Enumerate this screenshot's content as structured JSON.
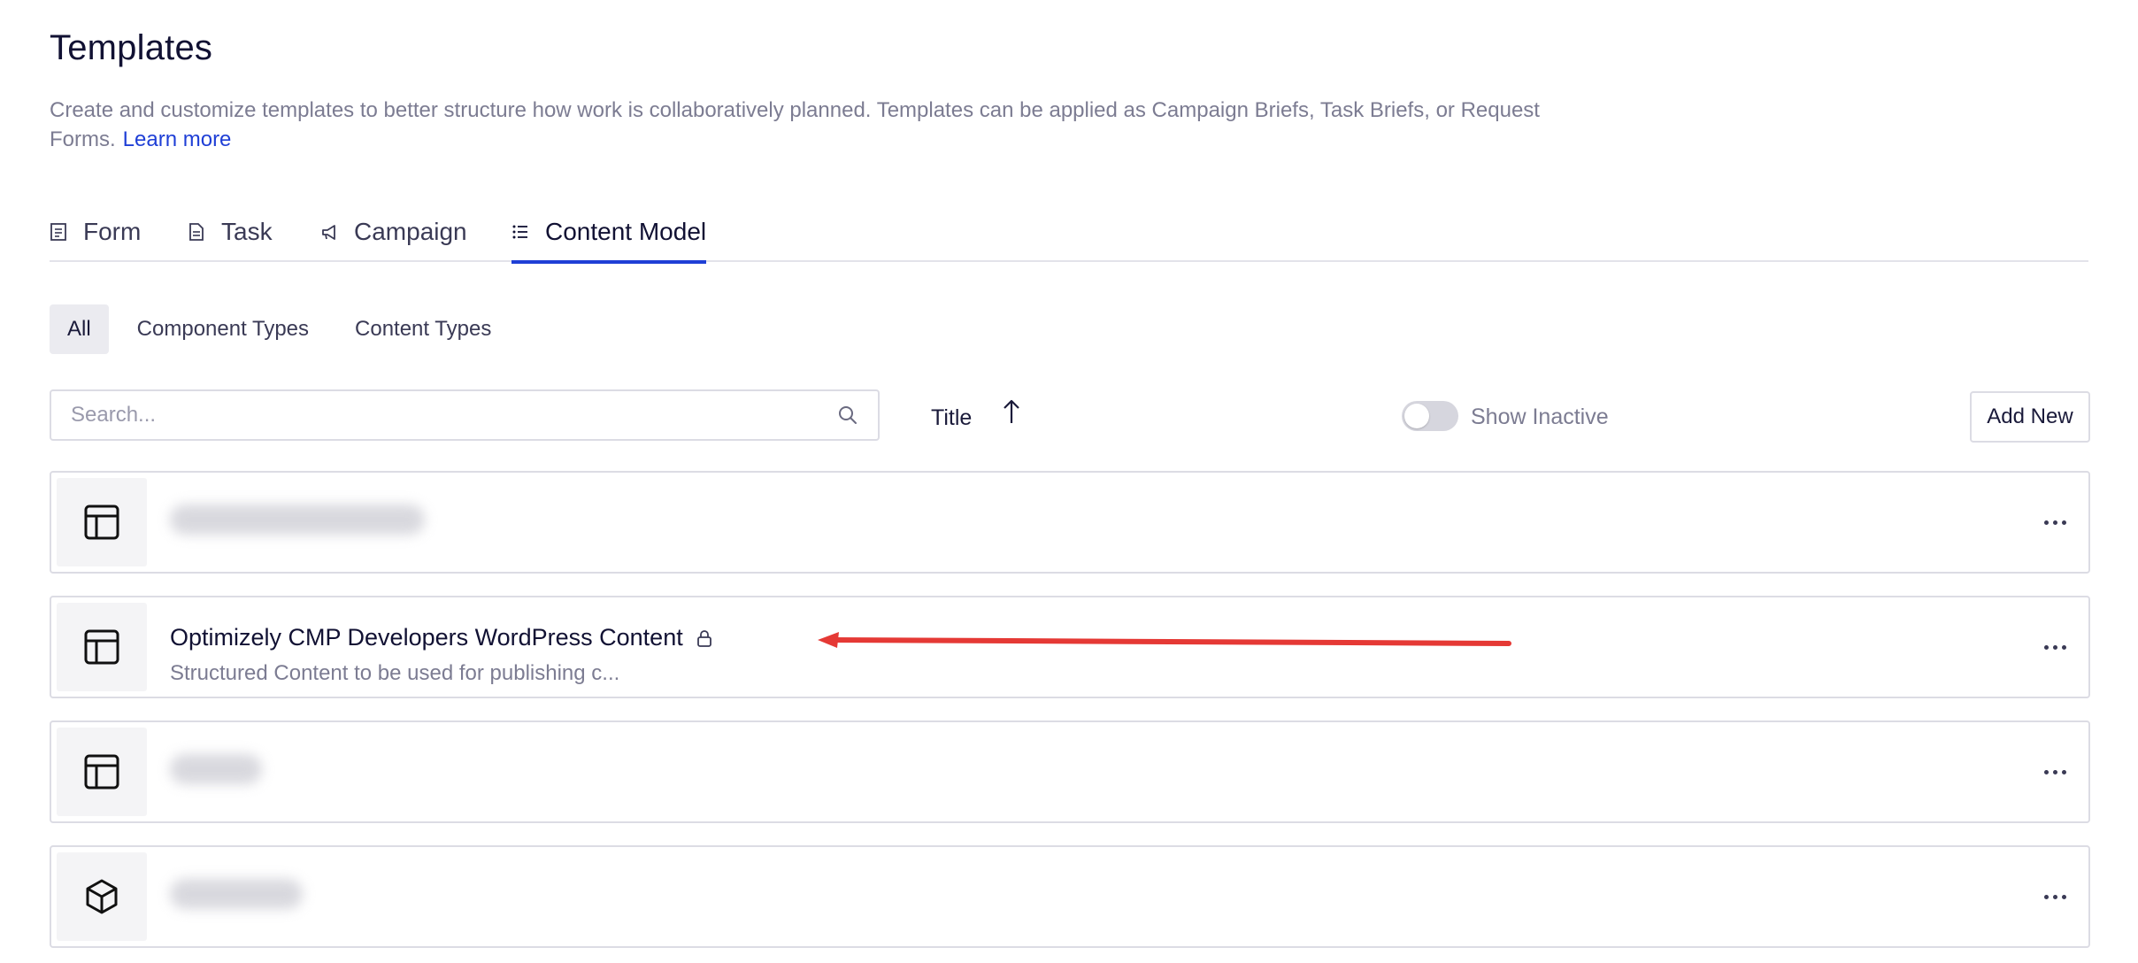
{
  "page": {
    "title": "Templates",
    "description": "Create and customize templates to better structure how work is collaboratively planned. Templates can be applied as Campaign Briefs, Task Briefs, or Request Forms.",
    "learn_more": "Learn more"
  },
  "tabs": [
    {
      "label": "Form",
      "icon": "form-icon"
    },
    {
      "label": "Task",
      "icon": "document-icon"
    },
    {
      "label": "Campaign",
      "icon": "megaphone-icon"
    },
    {
      "label": "Content Model",
      "icon": "list-icon",
      "active": true
    }
  ],
  "filters": [
    {
      "label": "All",
      "active": true
    },
    {
      "label": "Component Types"
    },
    {
      "label": "Content Types"
    }
  ],
  "toolbar": {
    "search_placeholder": "Search...",
    "sort_label": "Title",
    "sort_direction": "ascending",
    "show_inactive_label": "Show Inactive",
    "show_inactive_on": false,
    "add_new_label": "Add New"
  },
  "rows": [
    {
      "title": "",
      "subtitle": "",
      "icon": "layout-icon",
      "blurred": true
    },
    {
      "title": "Optimizely CMP Developers WordPress Content",
      "subtitle": "Structured Content to be used for publishing c...",
      "icon": "layout-icon",
      "locked": true
    },
    {
      "title": "",
      "subtitle": "",
      "icon": "layout-icon",
      "blurred": true
    },
    {
      "title": "",
      "subtitle": "",
      "icon": "cube-icon",
      "blurred": true
    }
  ],
  "colors": {
    "accent": "#1f3fd6",
    "annotation": "#e53935"
  }
}
